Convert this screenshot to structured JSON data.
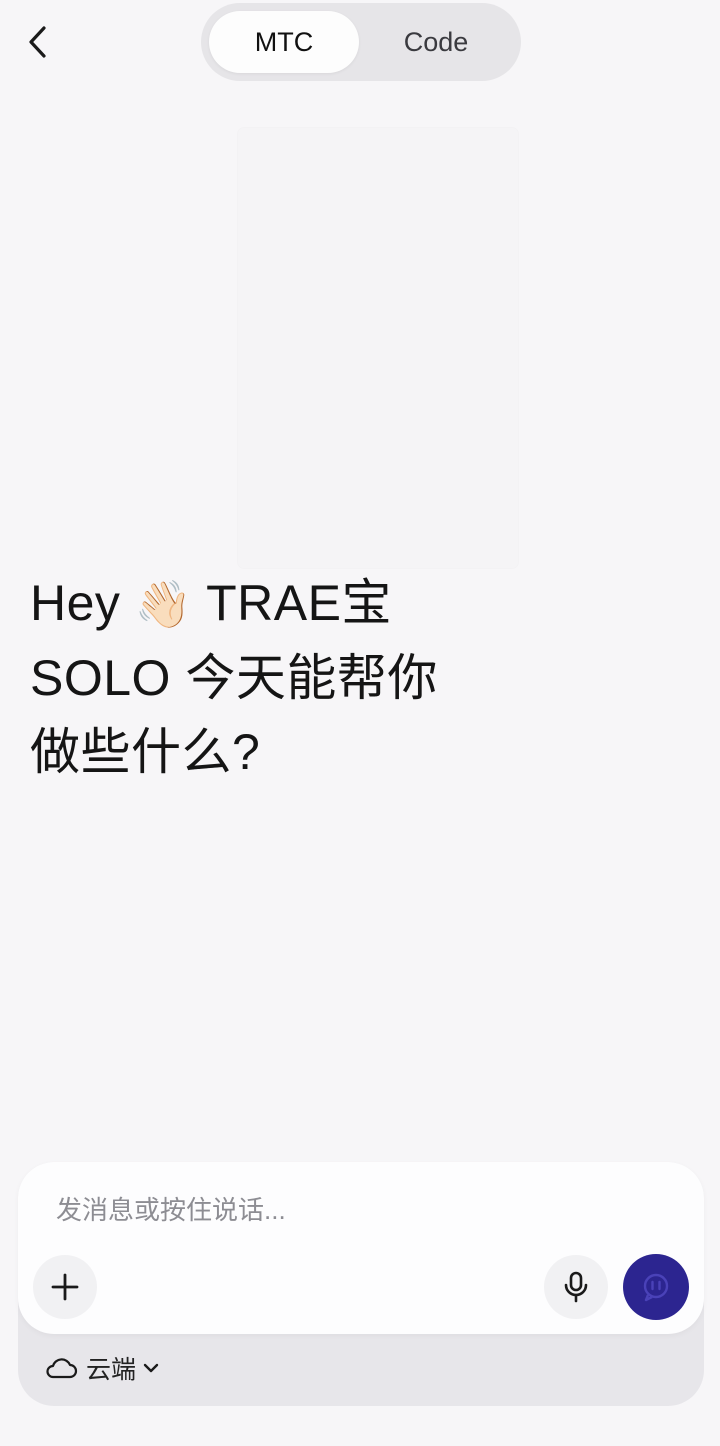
{
  "header": {
    "back_icon": "chevron-left-icon",
    "tabs": [
      {
        "label": "MTC",
        "active": true
      },
      {
        "label": "Code",
        "active": false
      }
    ]
  },
  "greeting": {
    "line1_prefix": "Hey",
    "wave_emoji": "👋🏻",
    "line1_suffix": "TRAE宝",
    "line2": "SOLO 今天能帮你",
    "line3": "做些什么?"
  },
  "composer": {
    "placeholder": "发消息或按住说话...",
    "value": "",
    "plus_icon": "plus-icon",
    "mic_icon": "microphone-icon",
    "send_icon": "send-icon",
    "mode_label": "云端",
    "mode_icon": "cloud-icon",
    "dropdown_icon": "chevron-down-icon"
  },
  "colors": {
    "background": "#f7f6f8",
    "send_button": "#2c2590",
    "segment_bg": "#e6e5e8"
  }
}
